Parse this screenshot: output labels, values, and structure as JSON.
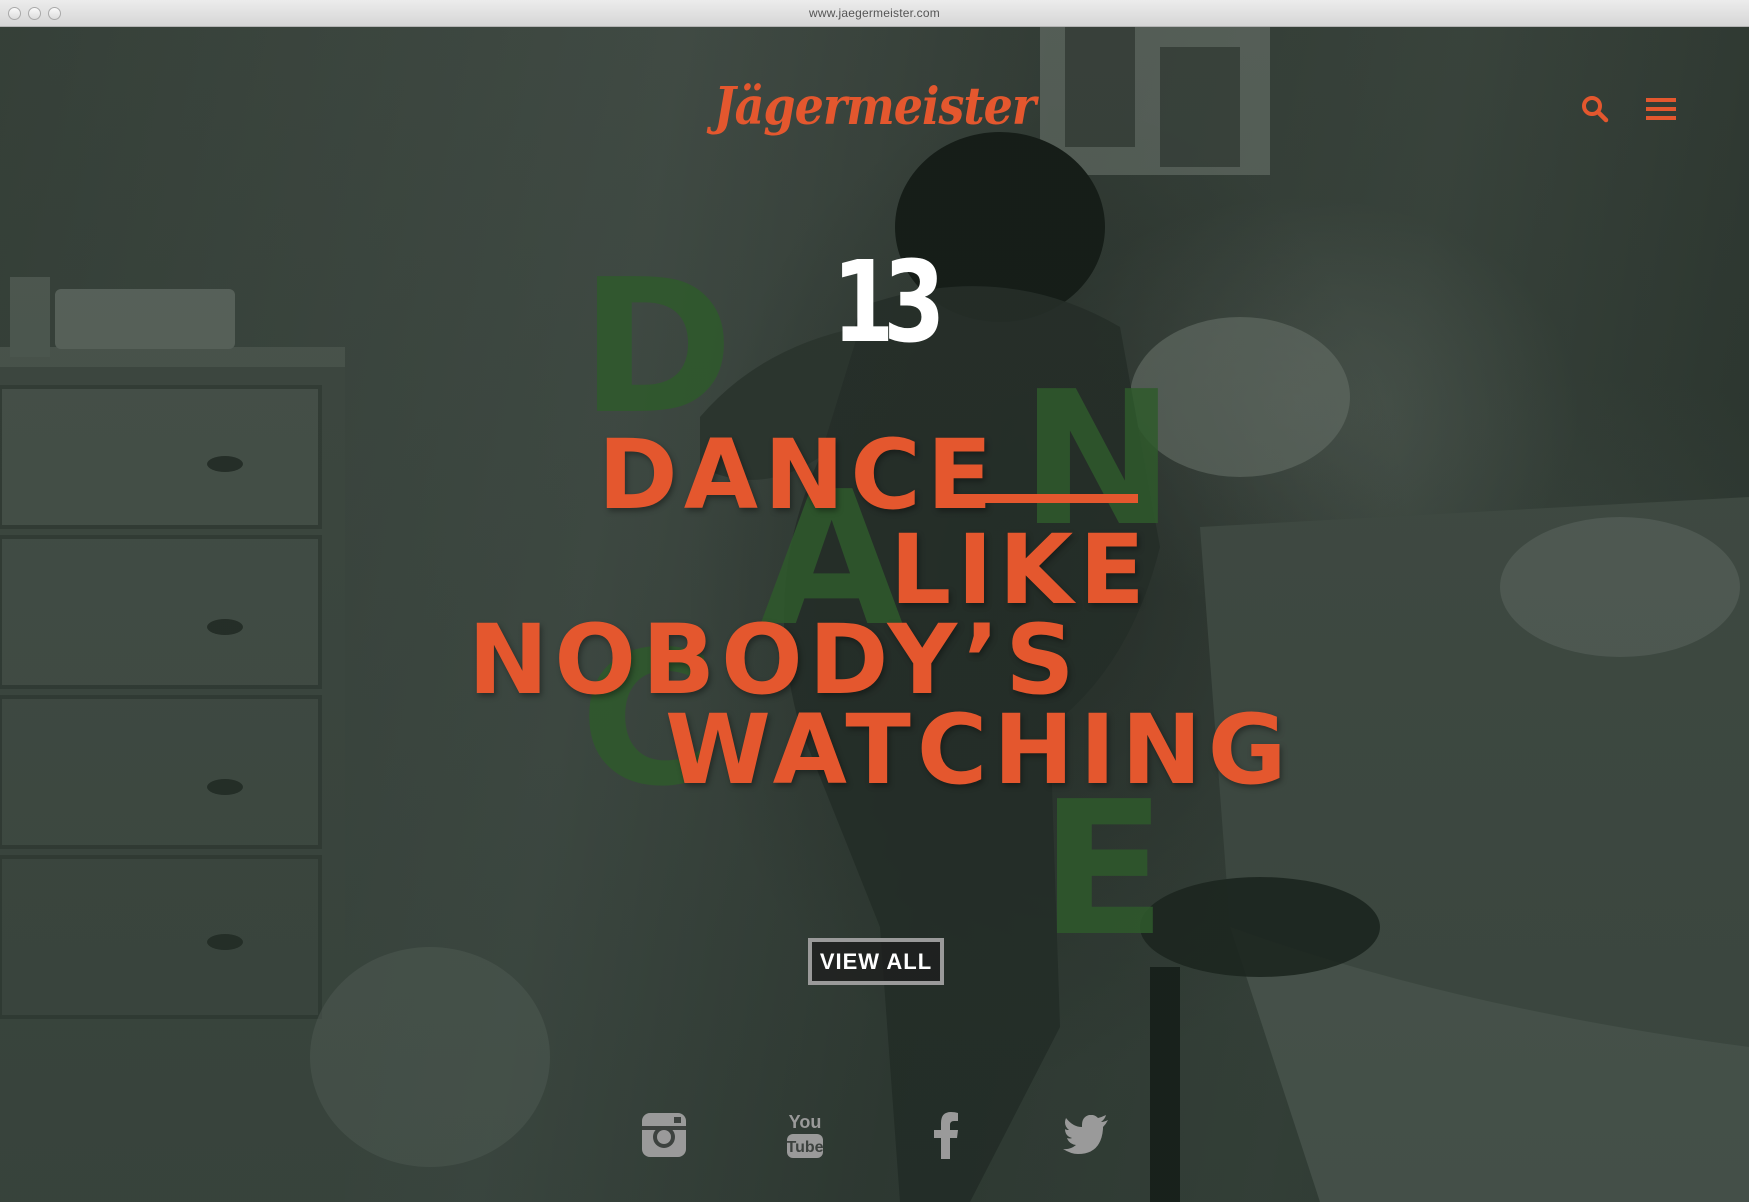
{
  "browser": {
    "url": "www.jaegermeister.com"
  },
  "header": {
    "logo_text": "Jägermeister",
    "search_icon": "search-icon",
    "menu_icon": "hamburger-menu-icon"
  },
  "hero": {
    "episode_mark": "13",
    "background_letters": [
      "D",
      "N",
      "A",
      "C",
      "E"
    ],
    "headline_lines": [
      "DANCE",
      "LIKE",
      "NOBODY’S",
      "WATCHING"
    ],
    "view_all_label": "VIEW ALL"
  },
  "social": {
    "icons": [
      "instagram-icon",
      "youtube-icon",
      "facebook-icon",
      "twitter-icon"
    ],
    "youtube_text": [
      "You",
      "Tube"
    ]
  },
  "colors": {
    "accent": "#e4572e",
    "dance_green": "#2f5a2c",
    "icon_gray": "#9a9a9a"
  }
}
